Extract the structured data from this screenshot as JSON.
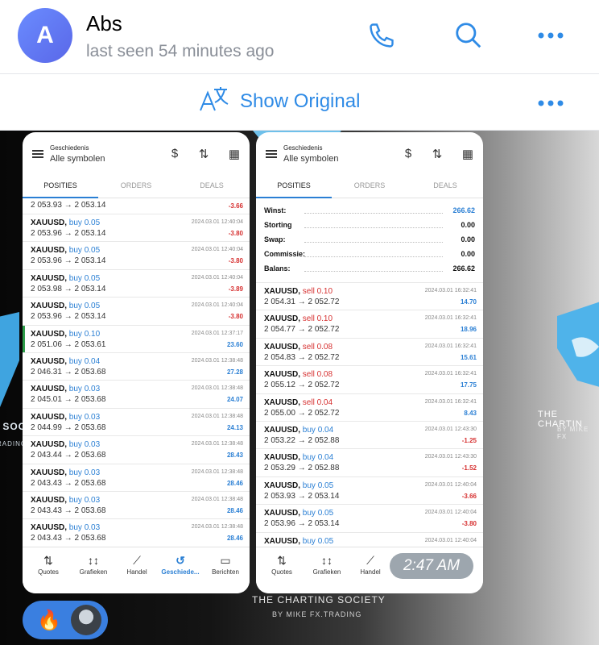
{
  "header": {
    "avatar_letter": "A",
    "name": "Abs",
    "status": "last seen 54 minutes ago",
    "icons": [
      "phone-icon",
      "search-icon",
      "more-icon"
    ]
  },
  "translate_bar": {
    "label": "Show Original",
    "icons": [
      "translate-icon",
      "more-icon"
    ]
  },
  "background_text": {
    "left_1": "S SOC",
    "left_2": "RADING",
    "right_1": "THE CHARTIN",
    "right_2": "BY MIKE FX",
    "bottom_1": "THE CHARTING SOCIETY",
    "bottom_2": "BY MIKE FX.TRADING"
  },
  "screen1": {
    "title": "Geschiedenis",
    "subtitle": "Alle symbolen",
    "tabs": [
      "POSITIES",
      "ORDERS",
      "DEALS"
    ],
    "first_partial": {
      "px": "2 053.93 → 2 053.14",
      "pl": "-3.66"
    },
    "rows": [
      {
        "sym": "XAUUSD,",
        "side": "buy 0.05",
        "px": "2 053.96 → 2 053.14",
        "dt": "2024.03.01 12:40:04",
        "pl": "-3.80",
        "dir": "neg"
      },
      {
        "sym": "XAUUSD,",
        "side": "buy 0.05",
        "px": "2 053.96 → 2 053.14",
        "dt": "2024.03.01 12:40:04",
        "pl": "-3.80",
        "dir": "neg"
      },
      {
        "sym": "XAUUSD,",
        "side": "buy 0.05",
        "px": "2 053.98 → 2 053.14",
        "dt": "2024.03.01 12:40:04",
        "pl": "-3.89",
        "dir": "neg"
      },
      {
        "sym": "XAUUSD,",
        "side": "buy 0.05",
        "px": "2 053.96 → 2 053.14",
        "dt": "2024.03.01 12:40:04",
        "pl": "-3.80",
        "dir": "neg"
      },
      {
        "sym": "XAUUSD,",
        "side": "buy 0.10",
        "px": "2 051.06 → 2 053.61",
        "dt": "2024.03.01 12:37:17",
        "pl": "23.60",
        "dir": "pos"
      },
      {
        "sym": "XAUUSD,",
        "side": "buy 0.04",
        "px": "2 046.31 → 2 053.68",
        "dt": "2024.03.01 12:38:48",
        "pl": "27.28",
        "dir": "pos"
      },
      {
        "sym": "XAUUSD,",
        "side": "buy 0.03",
        "px": "2 045.01 → 2 053.68",
        "dt": "2024.03.01 12:38:48",
        "pl": "24.07",
        "dir": "pos"
      },
      {
        "sym": "XAUUSD,",
        "side": "buy 0.03",
        "px": "2 044.99 → 2 053.68",
        "dt": "2024.03.01 12:38:48",
        "pl": "24.13",
        "dir": "pos"
      },
      {
        "sym": "XAUUSD,",
        "side": "buy 0.03",
        "px": "2 043.44 → 2 053.68",
        "dt": "2024.03.01 12:38:48",
        "pl": "28.43",
        "dir": "pos"
      },
      {
        "sym": "XAUUSD,",
        "side": "buy 0.03",
        "px": "2 043.43 → 2 053.68",
        "dt": "2024.03.01 12:38:48",
        "pl": "28.46",
        "dir": "pos"
      },
      {
        "sym": "XAUUSD,",
        "side": "buy 0.03",
        "px": "2 043.43 → 2 053.68",
        "dt": "2024.03.01 12:38:48",
        "pl": "28.46",
        "dir": "pos"
      },
      {
        "sym": "XAUUSD,",
        "side": "buy 0.03",
        "px": "2 043.43 → 2 053.68",
        "dt": "2024.03.01 12:38:48",
        "pl": "28.46",
        "dir": "pos"
      }
    ],
    "nav": [
      "Quotes",
      "Grafieken",
      "Handel",
      "Geschiede...",
      "Berichten"
    ]
  },
  "screen2": {
    "title": "Geschiedenis",
    "subtitle": "Alle symbolen",
    "tabs": [
      "POSITIES",
      "ORDERS",
      "DEALS"
    ],
    "summary": [
      {
        "k": "Winst:",
        "v": "266.62"
      },
      {
        "k": "Storting",
        "v": "0.00"
      },
      {
        "k": "Swap:",
        "v": "0.00"
      },
      {
        "k": "Commissie:",
        "v": "0.00"
      },
      {
        "k": "Balans:",
        "v": "266.62"
      }
    ],
    "rows": [
      {
        "sym": "XAUUSD,",
        "side": "sell 0.10",
        "px": "2 054.31 → 2 052.72",
        "dt": "2024.03.01 16:32:41",
        "pl": "14.70",
        "dir": "pos",
        "type": "sell"
      },
      {
        "sym": "XAUUSD,",
        "side": "sell 0.10",
        "px": "2 054.77 → 2 052.72",
        "dt": "2024.03.01 16:32:41",
        "pl": "18.96",
        "dir": "pos",
        "type": "sell"
      },
      {
        "sym": "XAUUSD,",
        "side": "sell 0.08",
        "px": "2 054.83 → 2 052.72",
        "dt": "2024.03.01 16:32:41",
        "pl": "15.61",
        "dir": "pos",
        "type": "sell"
      },
      {
        "sym": "XAUUSD,",
        "side": "sell 0.08",
        "px": "2 055.12 → 2 052.72",
        "dt": "2024.03.01 16:32:41",
        "pl": "17.75",
        "dir": "pos",
        "type": "sell"
      },
      {
        "sym": "XAUUSD,",
        "side": "sell 0.04",
        "px": "2 055.00 → 2 052.72",
        "dt": "2024.03.01 16:32:41",
        "pl": "8.43",
        "dir": "pos",
        "type": "sell"
      },
      {
        "sym": "XAUUSD,",
        "side": "buy 0.04",
        "px": "2 053.22 → 2 052.88",
        "dt": "2024.03.01 12:43:30",
        "pl": "-1.25",
        "dir": "neg",
        "type": "buy"
      },
      {
        "sym": "XAUUSD,",
        "side": "buy 0.04",
        "px": "2 053.29 → 2 052.88",
        "dt": "2024.03.01 12:43:30",
        "pl": "-1.52",
        "dir": "neg",
        "type": "buy"
      },
      {
        "sym": "XAUUSD,",
        "side": "buy 0.05",
        "px": "2 053.93 → 2 053.14",
        "dt": "2024.03.01 12:40:04",
        "pl": "-3.66",
        "dir": "neg",
        "type": "buy"
      },
      {
        "sym": "XAUUSD,",
        "side": "buy 0.05",
        "px": "2 053.96 → 2 053.14",
        "dt": "2024.03.01 12:40:04",
        "pl": "-3.80",
        "dir": "neg",
        "type": "buy"
      },
      {
        "sym": "XAUUSD,",
        "side": "buy 0.05",
        "px": "",
        "dt": "2024.03.01 12:40:04",
        "pl": "",
        "dir": "neg",
        "type": "buy"
      }
    ],
    "nav": [
      "Quotes",
      "Grafieken",
      "Handel"
    ]
  },
  "message": {
    "time": "2:47 AM",
    "reaction_emoji": "🔥"
  },
  "colors": {
    "accent": "#2f8be6",
    "buy": "#2a7fd4",
    "sell": "#d63030",
    "reaction_bg": "#3a7fe0"
  }
}
